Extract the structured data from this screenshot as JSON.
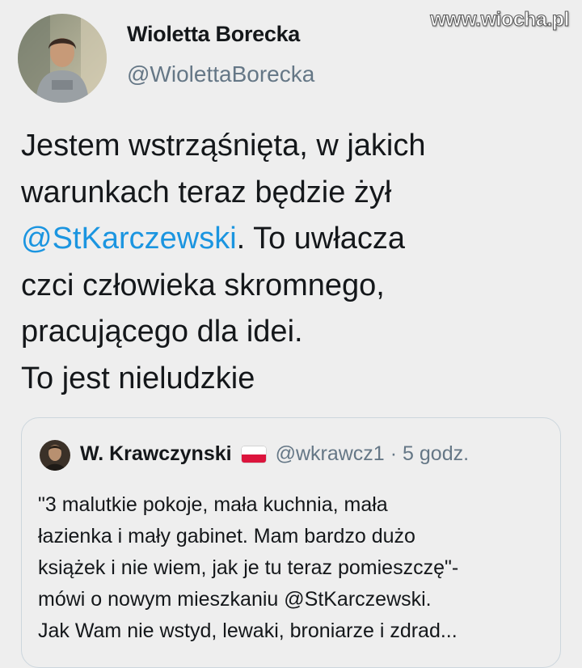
{
  "watermark": "www.wiocha.pl",
  "author": {
    "name": "Wioletta Borecka",
    "handle": "@WiolettaBorecka"
  },
  "tweet": {
    "lines": [
      {
        "pre": "Jestem wstrząśnięta, w jakich",
        "mention": "",
        "post": ""
      },
      {
        "pre": "warunkach teraz będzie żył",
        "mention": "",
        "post": ""
      },
      {
        "pre": "",
        "mention": "@StKarczewski",
        "post": ". To uwłacza"
      },
      {
        "pre": "czci człowieka skromnego,",
        "mention": "",
        "post": ""
      },
      {
        "pre": "pracującego dla idei.",
        "mention": "",
        "post": ""
      },
      {
        "pre": "To jest nieludzkie",
        "mention": "",
        "post": ""
      }
    ]
  },
  "quote": {
    "name": "W. Krawczynski",
    "handle": "@wkrawcz1",
    "separator": "·",
    "time": "5 godz.",
    "lines": [
      "\"3 malutkie pokoje, mała kuchnia, mała",
      "łazienka i mały gabinet. Mam bardzo dużo",
      "książek i nie wiem, jak je tu teraz pomieszczę\"-",
      "mówi o nowym mieszkaniu @StKarczewski.",
      "Jak Wam nie wstyd, lewaki, broniarze i zdrad..."
    ]
  },
  "icons": {
    "author_avatar": "profile-photo-icon",
    "quote_avatar": "profile-photo-icon",
    "flag": "poland-flag-icon"
  },
  "colors": {
    "background": "#eeeeee",
    "text": "#14171a",
    "secondary": "#657786",
    "mention": "#1b95e0",
    "border": "#ccd6dd"
  }
}
